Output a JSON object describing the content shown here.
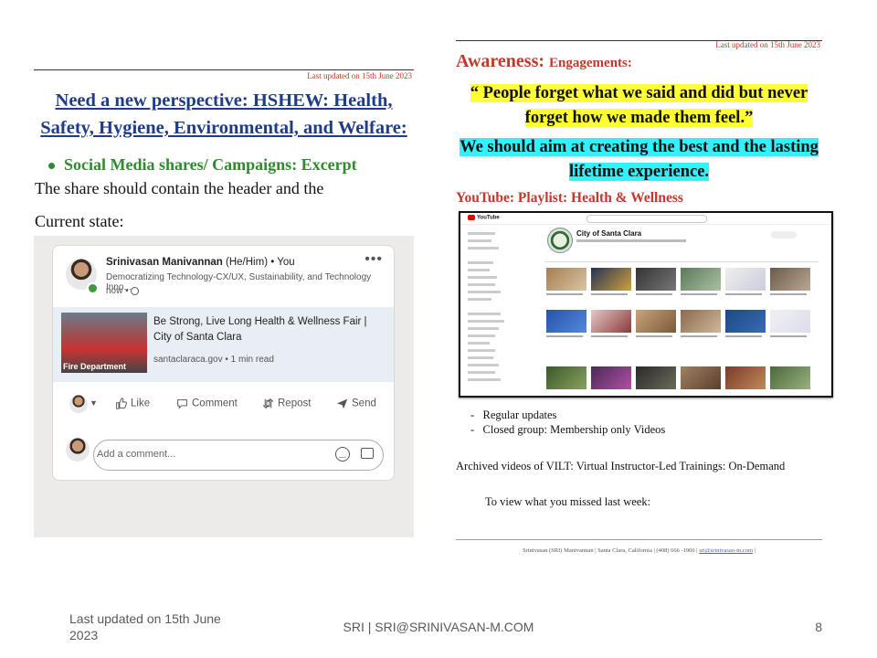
{
  "left_doc": {
    "last_updated": "Last updated on 15th June 2023",
    "heading": "Need a new perspective: HSHEW: Health, Safety, Hygiene, Environmental, and Welfare:",
    "bullet": "Social Media shares/ Campaigns: Excerpt",
    "share_text": "The share should contain the header and the",
    "current_state": "Current state:",
    "linkedin_post": {
      "author": "Srinivasan Manivannan",
      "pronoun_you": "(He/Him) • You",
      "tagline": "Democratizing Technology-CX/UX, Sustainability, and Technology Inno...",
      "meta": "now •",
      "more": "•••",
      "link_title": "Be Strong, Live Long Health & Wellness Fair | City of Santa Clara",
      "link_source": "santaclaraca.gov • 1 min read",
      "thumb_caption": "Fire Department",
      "actions": {
        "like": "Like",
        "comment": "Comment",
        "repost": "Repost",
        "send": "Send"
      },
      "comment_placeholder": "Add a comment..."
    }
  },
  "right_doc": {
    "last_updated": "Last updated on 15th June 2023",
    "awareness": "Awareness:",
    "engagements": "Engagements:",
    "quote": "“ People forget what we said and did but never forget how we made them feel.”",
    "aim": "We should aim at creating the best and the lasting lifetime experience.",
    "youtube_heading": "YouTube: Playlist: Health & Wellness",
    "youtube": {
      "logo": "YouTube",
      "channel": "City of Santa Clara"
    },
    "regular_updates": "Regular updates",
    "closed_group": "Closed group: Membership only Videos",
    "archived": "Archived videos of VILT: Virtual Instructor-Led Trainings: On-Demand",
    "view_missed": "To view what you missed last week:",
    "footer_text": "Srinivasan (SRI) Manivannan | Santa Clara, California | (408) 666 -1906 |",
    "footer_link": "sri@srinivasan-m.com",
    "footer_end": "|"
  },
  "slide_footer": {
    "date": "Last updated on 15th June 2023",
    "center": "SRI | SRI@SRINIVASAN-M.COM",
    "page": "8"
  }
}
